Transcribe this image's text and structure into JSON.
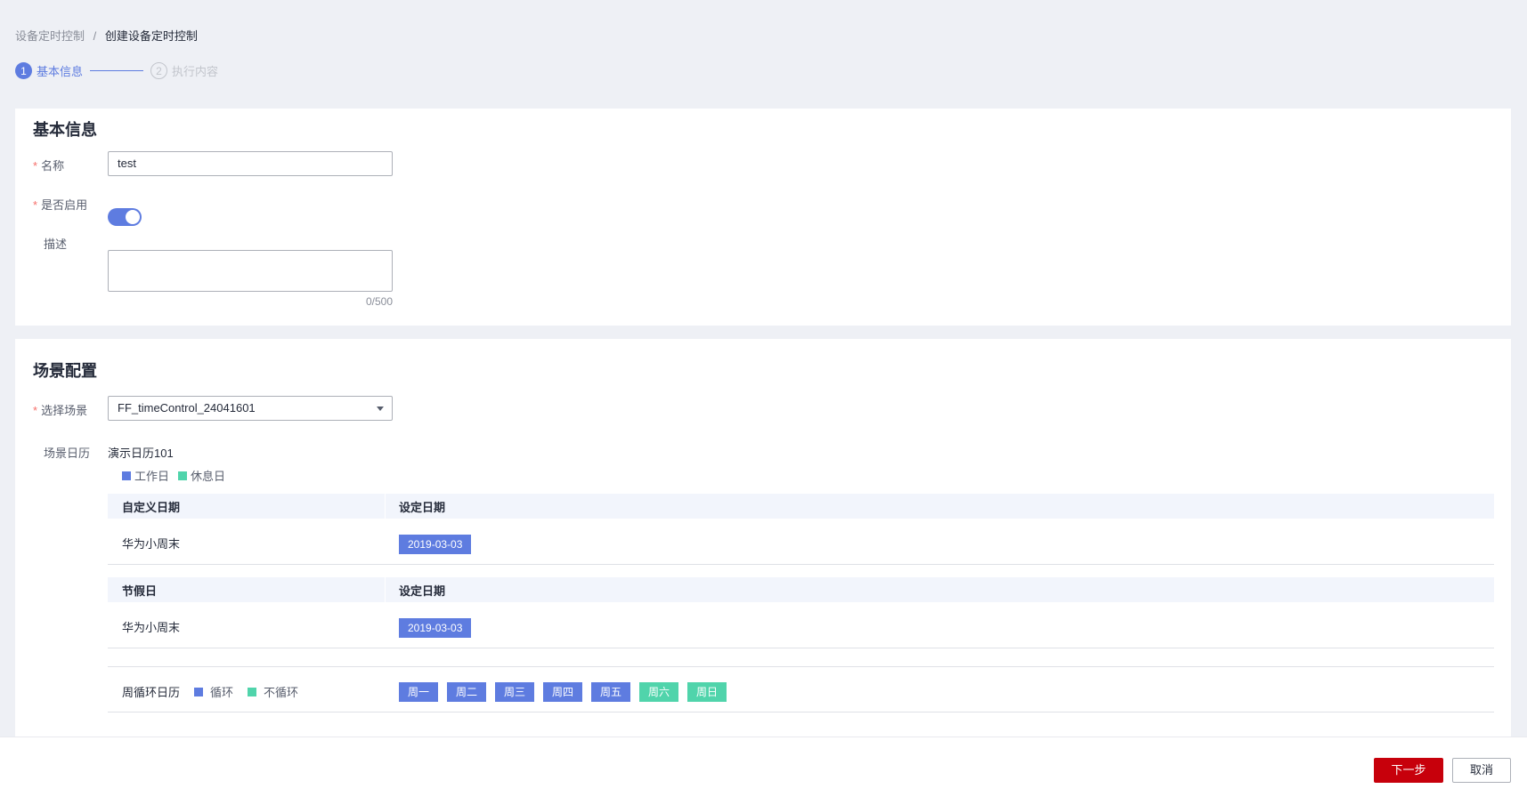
{
  "breadcrumb": {
    "parent": "设备定时控制",
    "separator": "/",
    "current": "创建设备定时控制"
  },
  "steps": [
    {
      "num": "1",
      "label": "基本信息",
      "state": "active"
    },
    {
      "num": "2",
      "label": "执行内容",
      "state": "inactive"
    }
  ],
  "basic": {
    "title": "基本信息",
    "name_label": "名称",
    "name_value": "test",
    "enable_label": "是否启用",
    "enabled": true,
    "desc_label": "描述",
    "desc_counter": "0/500"
  },
  "scene": {
    "title": "场景配置",
    "select_label": "选择场景",
    "select_value": "FF_timeControl_24041601",
    "calendar_label": "场景日历",
    "calendar_name": "演示日历101",
    "legend_workday": "工作日",
    "legend_restday": "休息日",
    "custom_table": {
      "col1": "自定义日期",
      "col2": "设定日期",
      "row_name": "华为小周末",
      "row_date": "2019-03-03"
    },
    "holiday_table": {
      "col1": "节假日",
      "col2": "设定日期",
      "row_name": "华为小周末",
      "row_date": "2019-03-03"
    },
    "week": {
      "label": "周循环日历",
      "legend_cycle": "循环",
      "legend_noncycle": "不循环",
      "days": [
        {
          "label": "周一",
          "type": "blue"
        },
        {
          "label": "周二",
          "type": "blue"
        },
        {
          "label": "周三",
          "type": "blue"
        },
        {
          "label": "周四",
          "type": "blue"
        },
        {
          "label": "周五",
          "type": "blue"
        },
        {
          "label": "周六",
          "type": "green"
        },
        {
          "label": "周日",
          "type": "green"
        }
      ]
    }
  },
  "footer": {
    "next_label": "下一步",
    "cancel_label": "取消"
  },
  "colors": {
    "accent": "#5e7ce0",
    "rest": "#50d4ab",
    "primary_button": "#c7000b",
    "required": "#f66f6a"
  }
}
